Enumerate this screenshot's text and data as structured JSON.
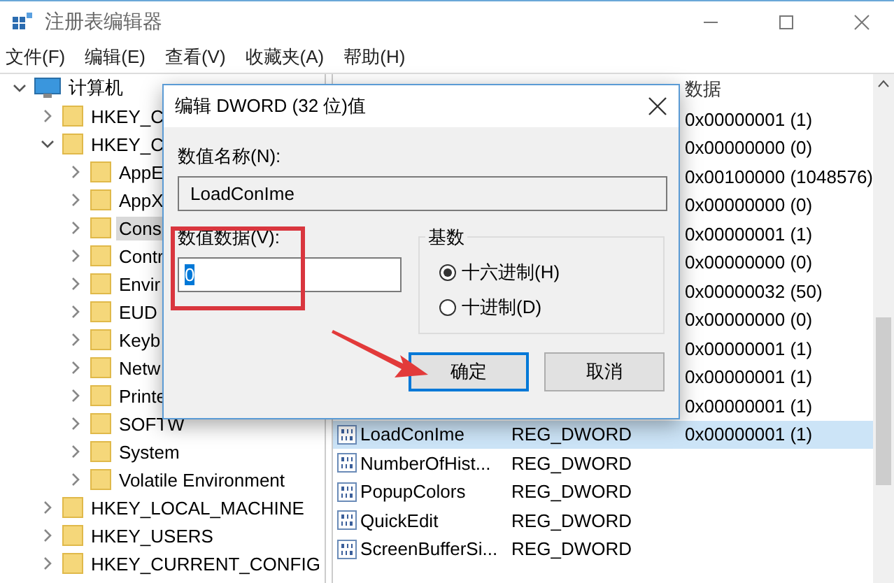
{
  "window": {
    "title": "注册表编辑器"
  },
  "menu": [
    "文件(F)",
    "编辑(E)",
    "查看(V)",
    "收藏夹(A)",
    "帮助(H)"
  ],
  "tree": {
    "label": "计算机",
    "kind": "computer",
    "expanded": true,
    "selected": false,
    "children": [
      {
        "label": "HKEY_C",
        "expanded": false,
        "selected": false
      },
      {
        "label": "HKEY_C",
        "expanded": true,
        "selected": false,
        "children": [
          {
            "label": "AppE",
            "expanded": false,
            "selected": false
          },
          {
            "label": "AppX",
            "expanded": false,
            "selected": false
          },
          {
            "label": "Cons",
            "expanded": false,
            "selected": true
          },
          {
            "label": "Contr",
            "expanded": false,
            "selected": false
          },
          {
            "label": "Envir",
            "expanded": false,
            "selected": false
          },
          {
            "label": "EUD",
            "expanded": false,
            "selected": false
          },
          {
            "label": "Keyb",
            "expanded": false,
            "selected": false
          },
          {
            "label": "Netw",
            "expanded": false,
            "selected": false
          },
          {
            "label": "Printe",
            "expanded": false,
            "selected": false
          },
          {
            "label": "SOFTW",
            "expanded": false,
            "selected": false
          },
          {
            "label": "System",
            "expanded": false,
            "selected": false
          },
          {
            "label": "Volatile Environment",
            "expanded": false,
            "selected": false
          }
        ]
      },
      {
        "label": "HKEY_LOCAL_MACHINE",
        "expanded": false,
        "selected": false
      },
      {
        "label": "HKEY_USERS",
        "expanded": false,
        "selected": false
      },
      {
        "label": "HKEY_CURRENT_CONFIG",
        "expanded": false,
        "selected": false
      }
    ]
  },
  "table": {
    "columns": [
      "数据"
    ],
    "rows": [
      {
        "data": "0x00000001 (1)",
        "selected": false
      },
      {
        "data": "0x00000000 (0)",
        "selected": false
      },
      {
        "data": "0x00100000 (1048576)",
        "selected": false
      },
      {
        "data": "0x00000000 (0)",
        "selected": false
      },
      {
        "data": "0x00000001 (1)",
        "selected": false
      },
      {
        "data": "0x00000000 (0)",
        "selected": false
      },
      {
        "data": "0x00000032 (50)",
        "selected": false
      },
      {
        "data": "0x00000000 (0)",
        "selected": false
      },
      {
        "data": "0x00000001 (1)",
        "selected": false
      },
      {
        "data": "0x00000001 (1)",
        "selected": false
      },
      {
        "data": "0x00000001 (1)",
        "selected": false
      },
      {
        "name": "LoadConIme",
        "type": "REG_DWORD",
        "data": "0x00000001 (1)",
        "selected": true
      },
      {
        "name": "NumberOfHist...",
        "type": "REG_DWORD",
        "selected": false
      },
      {
        "name": "PopupColors",
        "type": "REG_DWORD",
        "selected": false
      },
      {
        "name": "QuickEdit",
        "type": "REG_DWORD",
        "selected": false
      },
      {
        "name": "ScreenBufferSi...",
        "type": "REG_DWORD",
        "selected": false
      }
    ]
  },
  "dialog": {
    "title": "编辑 DWORD (32 位)值",
    "name_label": "数值名称(N):",
    "name_value": "LoadConIme",
    "data_label": "数值数据(V):",
    "data_value": "0",
    "data_value_selected": true,
    "base_label": "基数",
    "radios": [
      {
        "label": "十六进制(H)",
        "selected": true
      },
      {
        "label": "十进制(D)",
        "selected": false
      }
    ],
    "buttons": [
      {
        "label": "确定",
        "default": true
      },
      {
        "label": "取消",
        "default": false
      }
    ]
  }
}
